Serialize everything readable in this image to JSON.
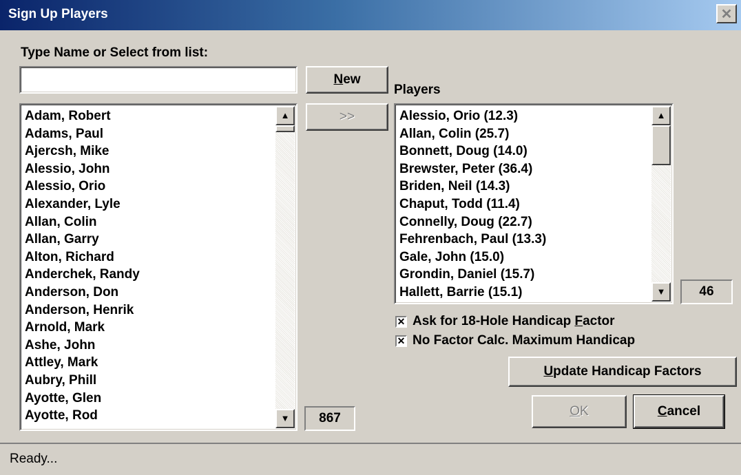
{
  "window": {
    "title": "Sign Up Players",
    "close_glyph": "✕"
  },
  "name_entry": {
    "label": "Type Name or Select from list:",
    "value": ""
  },
  "buttons": {
    "new": {
      "accel": "N",
      "rest": "ew"
    },
    "add": ">>",
    "update": {
      "accel": "U",
      "rest": "pdate Handicap Factors"
    },
    "ok": {
      "accel": "O",
      "rest": "K"
    },
    "cancel": {
      "accel": "C",
      "rest": "ancel"
    }
  },
  "all_players": {
    "items": [
      "Adam, Robert",
      "Adams, Paul",
      "Ajercsh, Mike",
      "Alessio, John",
      "Alessio, Orio",
      "Alexander, Lyle",
      "Allan, Colin",
      "Allan, Garry",
      "Alton, Richard",
      "Anderchek, Randy",
      "Anderson, Don",
      "Anderson, Henrik",
      "Arnold, Mark",
      "Ashe, John",
      "Attley, Mark",
      "Aubry, Phill",
      "Ayotte, Glen",
      "Ayotte, Rod"
    ],
    "count": "867"
  },
  "players": {
    "label": "Players",
    "items": [
      "Alessio, Orio (12.3)",
      "Allan, Colin (25.7)",
      "Bonnett, Doug (14.0)",
      "Brewster, Peter (36.4)",
      "Briden, Neil (14.3)",
      "Chaput, Todd (11.4)",
      "Connelly, Doug (22.7)",
      "Fehrenbach, Paul (13.3)",
      "Gale, John (15.0)",
      "Grondin, Daniel (15.7)",
      "Hallett, Barrie (15.1)"
    ],
    "count": "46"
  },
  "options": {
    "ask_factor": {
      "pre": "Ask for 18-Hole Handicap ",
      "accel": "F",
      "post": "actor",
      "checked": true
    },
    "no_factor_max": {
      "label": "No Factor Calc. Maximum Handicap",
      "checked": true
    }
  },
  "status": {
    "text": "Ready..."
  }
}
